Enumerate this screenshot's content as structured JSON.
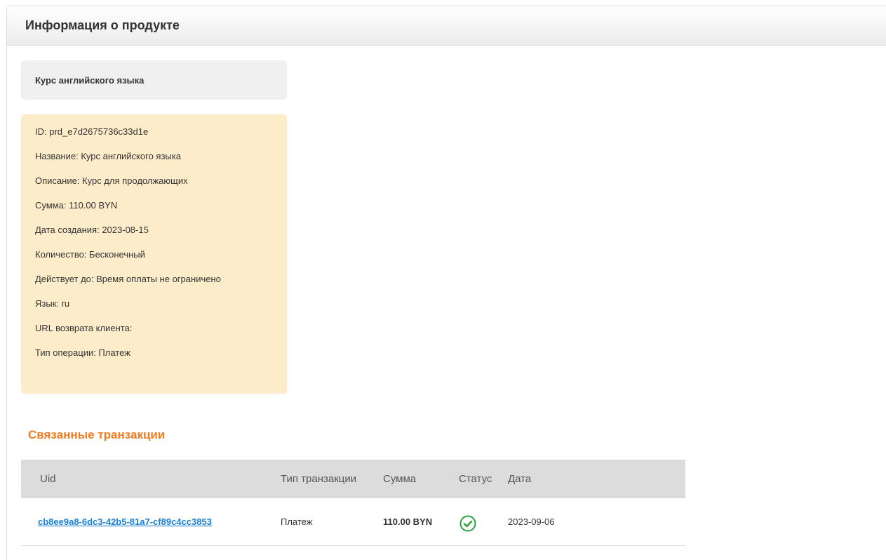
{
  "panel": {
    "title": "Информация о продукте"
  },
  "product": {
    "name": "Курс английского языка",
    "details": [
      "ID: prd_e7d2675736c33d1e",
      "Название: Курс английского языка",
      "Описание: Курс для продолжающих",
      "Сумма: 110.00 BYN",
      "Дата создания: 2023-08-15",
      "Количество: Бесконечный",
      "Действует до: Время оплаты не ограничено",
      "Язык: ru",
      "URL возврата клиента:",
      "Тип операции: Платеж"
    ]
  },
  "transactions": {
    "title": "Связанные транзакции",
    "columns": [
      "Uid",
      "Тип транзакции",
      "Сумма",
      "Статус",
      "Дата"
    ],
    "rows": [
      {
        "uid": "cb8ee9a8-6dc3-42b5-81a7-cf89c4cc3853",
        "type": "Платеж",
        "amount": "110.00 BYN",
        "status_icon": "check-circle-icon",
        "date": "2023-09-06"
      }
    ]
  },
  "colors": {
    "section_title": "#f47b20",
    "info_box_bg": "#fcecca",
    "link": "#1a7fd4",
    "status_success": "#2e9e3e"
  }
}
